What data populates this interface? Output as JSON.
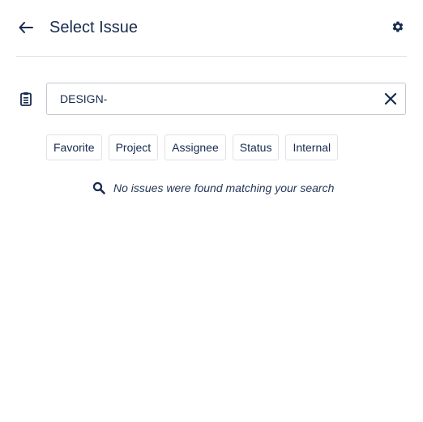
{
  "header": {
    "title": "Select Issue",
    "back_icon": "arrow-left-icon",
    "settings_icon": "gear-icon"
  },
  "search": {
    "type_icon": "clipboard-icon",
    "value": "DESIGN-",
    "clear_icon": "close-icon"
  },
  "filters": [
    {
      "label": "Favorite"
    },
    {
      "label": "Project"
    },
    {
      "label": "Assignee"
    },
    {
      "label": "Status"
    },
    {
      "label": "Internal"
    }
  ],
  "empty_state": {
    "icon": "search-icon",
    "message": "No issues were found matching your search"
  },
  "colors": {
    "text": "#172b4d",
    "border": "#c1c7d0",
    "divider": "#dfe1e6"
  }
}
